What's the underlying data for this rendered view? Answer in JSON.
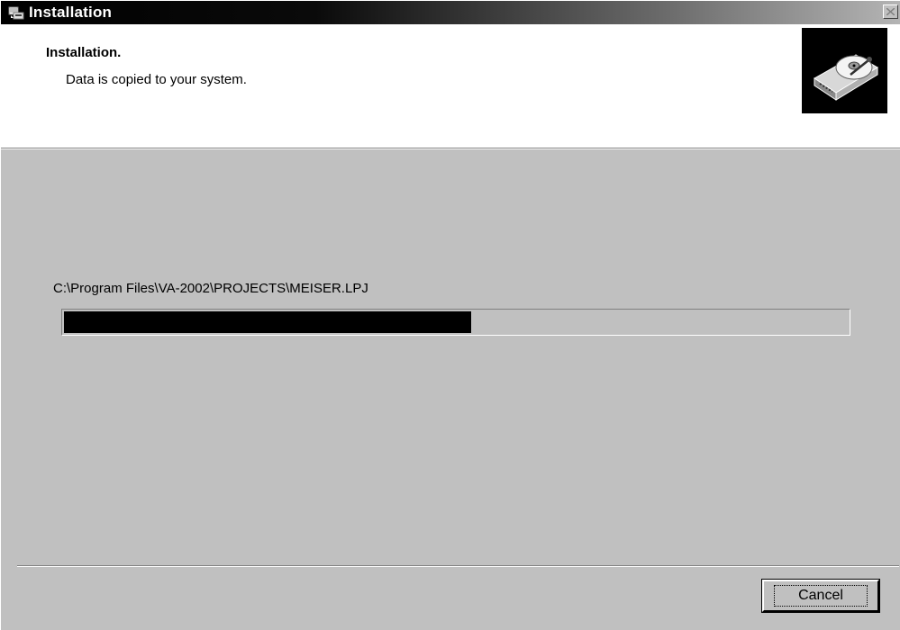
{
  "window": {
    "title": "Installation"
  },
  "header": {
    "title": "Installation.",
    "subtitle": "Data is copied to your system.",
    "image_icon": "hard-disk-icon"
  },
  "body": {
    "current_file": "C:\\Program Files\\VA-2002\\PROJECTS\\MEISER.LPJ",
    "progress_fraction": 0.52
  },
  "buttons": {
    "cancel_label": "Cancel"
  },
  "icons": {
    "title_icon": "installer-icon",
    "close_icon": "close-icon"
  },
  "colors": {
    "face": "#c0c0c0",
    "progress_fill": "#000000",
    "header_bg": "#ffffff"
  }
}
